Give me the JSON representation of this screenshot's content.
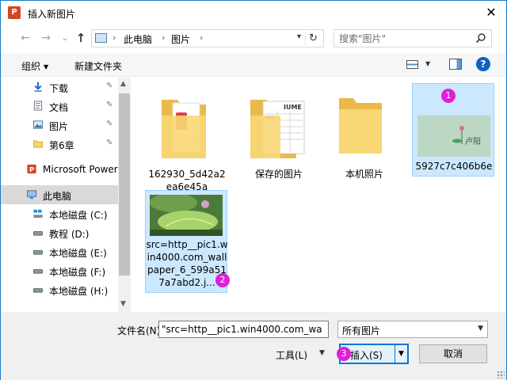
{
  "window": {
    "title": "插入新图片",
    "app_icon_letter": "P",
    "close_glyph": "✕"
  },
  "nav": {
    "back_glyph": "←",
    "forward_glyph": "→",
    "recent_glyph": "⌄",
    "up_glyph": "↑",
    "breadcrumb": [
      "此电脑",
      "图片"
    ],
    "breadcrumb_separator": "›",
    "refresh_glyph": "↻",
    "search_placeholder": "搜索\"图片\""
  },
  "toolbar": {
    "organize": "组织",
    "new_folder": "新建文件夹",
    "help_glyph": "?"
  },
  "navpane": {
    "items": [
      {
        "label": "下载",
        "icon": "download-arrow-icon",
        "pinned": true
      },
      {
        "label": "文档",
        "icon": "document-icon",
        "pinned": true
      },
      {
        "label": "图片",
        "icon": "pictures-icon",
        "pinned": true
      },
      {
        "label": "第6章",
        "icon": "folder-icon",
        "pinned": true
      },
      {
        "label": "Microsoft Power",
        "icon": "powerpoint-icon",
        "pinned": false
      },
      {
        "label": "此电脑",
        "icon": "this-pc-icon",
        "pinned": false,
        "selected": true
      },
      {
        "label": "本地磁盘 (C:)",
        "icon": "drive-icon",
        "pinned": false
      },
      {
        "label": "教程 (D:)",
        "icon": "drive-icon",
        "pinned": false
      },
      {
        "label": "本地磁盘 (E:)",
        "icon": "drive-icon",
        "pinned": false
      },
      {
        "label": "本地磁盘 (F:)",
        "icon": "drive-icon",
        "pinned": false
      },
      {
        "label": "本地磁盘 (H:)",
        "icon": "drive-icon",
        "pinned": false
      }
    ],
    "pin_glyph": "📌"
  },
  "files": [
    {
      "name": "162930_5d42a2ea6e45a",
      "type": "folder-with-pdf"
    },
    {
      "name": "保存的图片",
      "type": "folder-with-sheet"
    },
    {
      "name": "本机照片",
      "type": "folder"
    },
    {
      "name": "5927c7c406b6e",
      "type": "image-lotus",
      "badge": "1"
    },
    {
      "name": "src=http__pic1.win4000.com_wallpaper_6_599a517a7abd2.j...",
      "type": "image-leaf",
      "badge": "2"
    }
  ],
  "bottom": {
    "filename_label": "文件名(N):",
    "filename_value": "\"src=http__pic1.win4000.com_wa",
    "filter_value": "所有图片",
    "tools_label": "工具(L)",
    "insert_label": "插入(S)",
    "insert_badge": "3",
    "cancel_label": "取消"
  },
  "colors": {
    "accent": "#0078d7",
    "badge": "#e020d8",
    "selection": "#cce8ff"
  }
}
